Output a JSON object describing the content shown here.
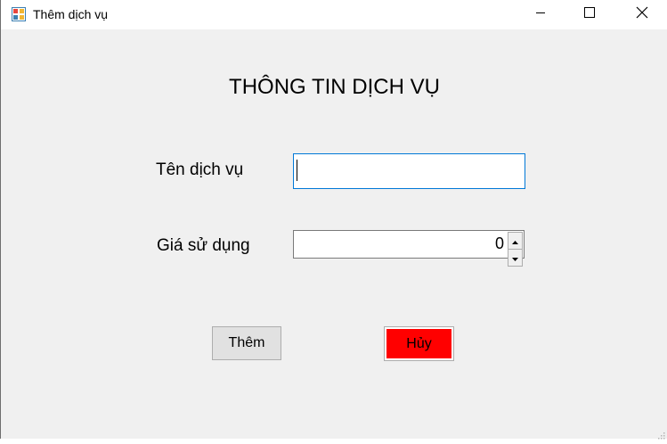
{
  "window": {
    "title": "Thêm dịch vụ",
    "icons": {
      "app": "form-app-icon",
      "minimize": "minimize-icon",
      "maximize": "maximize-icon",
      "close": "close-icon"
    }
  },
  "form": {
    "heading": "THÔNG TIN DỊCH VỤ",
    "service_name_label": "Tên dịch vụ",
    "service_name_value": "",
    "price_label": "Giá sử dụng",
    "price_value": "0"
  },
  "buttons": {
    "add_label": "Thêm",
    "cancel_label": "Hủy"
  },
  "colors": {
    "cancel_bg": "#ff0000",
    "focus_border": "#0078d7",
    "window_bg": "#f0f0f0"
  }
}
